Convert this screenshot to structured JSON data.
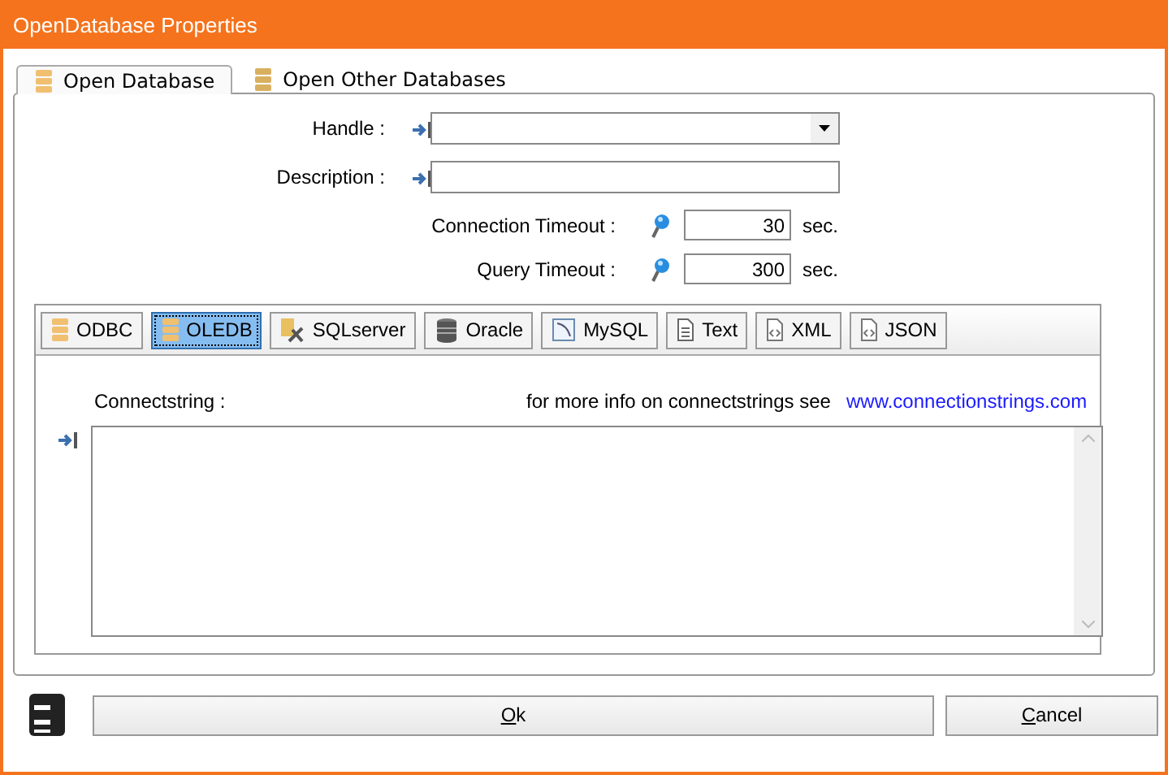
{
  "window": {
    "title": "OpenDatabase Properties"
  },
  "tabs": [
    {
      "label": "Open Database",
      "selected": true
    },
    {
      "label": "Open Other Databases",
      "selected": false
    }
  ],
  "fields": [
    {
      "label": "Handle :",
      "kind": "dropdown"
    },
    {
      "label": "Description :",
      "kind": "text"
    }
  ],
  "timeouts": [
    {
      "label": "Connection Timeout :",
      "value": "30",
      "unit": "sec."
    },
    {
      "label": "Query Timeout :",
      "value": "300",
      "unit": "sec."
    }
  ],
  "providers": [
    {
      "label": "ODBC",
      "kind": "db",
      "selected": false
    },
    {
      "label": "OLEDB",
      "kind": "db",
      "selected": true
    },
    {
      "label": "SQLserver",
      "kind": "sqlserver",
      "selected": false
    },
    {
      "label": "Oracle",
      "kind": "oracle",
      "selected": false
    },
    {
      "label": "MySQL",
      "kind": "mysql",
      "selected": false
    },
    {
      "label": "Text",
      "kind": "text",
      "selected": false
    },
    {
      "label": "XML",
      "kind": "xml",
      "selected": false
    },
    {
      "label": "JSON",
      "kind": "json",
      "selected": false
    }
  ],
  "connect": {
    "label": "Connectstring :",
    "info": "for more info on connectstrings see",
    "link": "www.connectionstrings.com"
  },
  "buttons": [
    {
      "label": "Ok",
      "mnemonic_underlined": true
    },
    {
      "label": "Cancel",
      "mnemonic_underlined": true
    }
  ]
}
